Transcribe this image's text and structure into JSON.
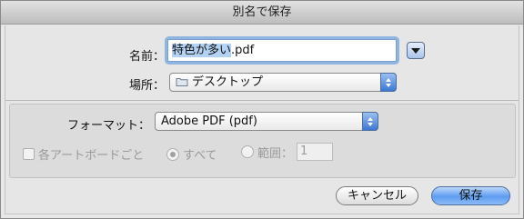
{
  "window": {
    "title": "別名で保存"
  },
  "save_name": {
    "label": "名前：",
    "selected_text": "特色が多い",
    "extension": ".pdf"
  },
  "location": {
    "label": "場所：",
    "value": "デスクトップ",
    "icon": "folder-icon"
  },
  "format": {
    "label": "フォーマット：",
    "value": "Adobe PDF (pdf)"
  },
  "options": {
    "each_artboard_label": "各アートボードごと",
    "all_label": "すべて",
    "range_label": "範囲：",
    "range_value": "1"
  },
  "buttons": {
    "cancel": "キャンセル",
    "save": "保存"
  },
  "colors": {
    "focus_ring": "#8fb5e0",
    "accent": "#3b78d4",
    "disabled_text": "#9a9a9a"
  }
}
